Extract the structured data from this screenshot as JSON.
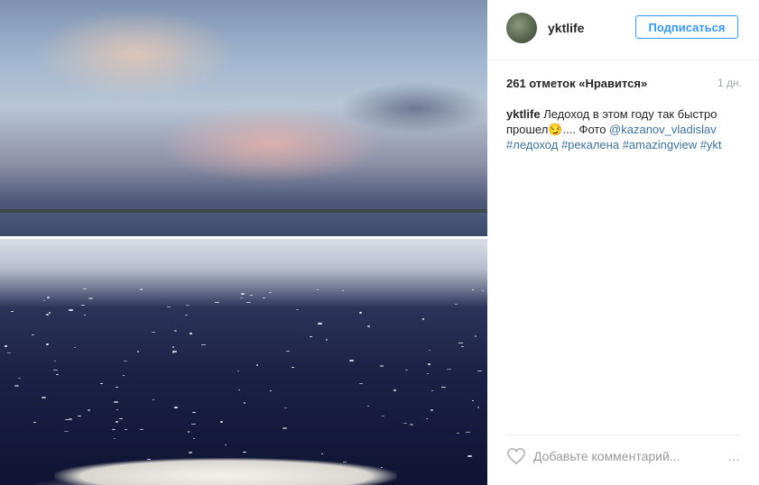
{
  "post": {
    "username": "yktlife",
    "follow_label": "Подписаться",
    "likes_text": "261 отметок «Нравится»",
    "time_ago": "1 дн.",
    "caption": {
      "user": "yktlife",
      "text_1": " Ледоход в этом году так быстро прошел",
      "emoji": "😏",
      "text_2": ".... Фото ",
      "mention": "@kazanov_vladislav",
      "hashtags": [
        "#ледоход",
        "#рекалена",
        "#amazingview",
        "#ykt"
      ]
    }
  },
  "comment": {
    "placeholder": "Добавьте комментарий...",
    "more_label": "…"
  },
  "icons": {
    "like": "heart-outline-icon",
    "more": "more-options-icon"
  },
  "colors": {
    "link": "#3f729b",
    "follow": "#3897f0"
  }
}
